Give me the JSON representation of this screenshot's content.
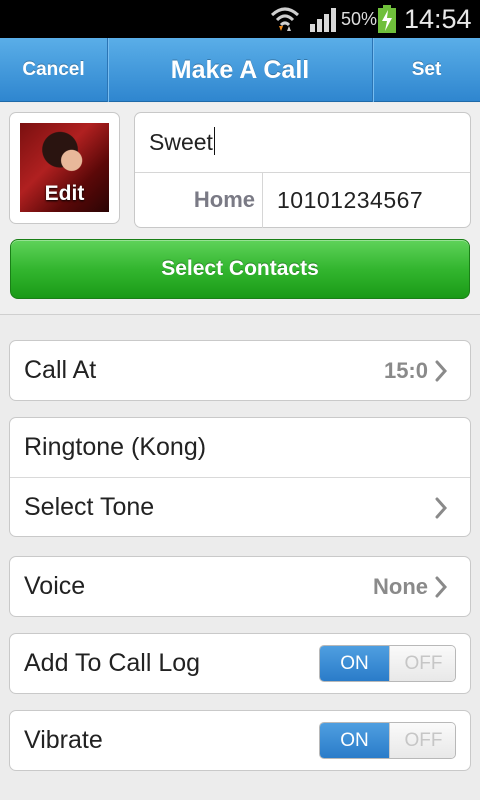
{
  "status_bar": {
    "battery_percent": "50%",
    "time": "14:54",
    "icons": [
      "wifi-icon",
      "signal-icon",
      "battery-charging-icon"
    ]
  },
  "header": {
    "cancel_label": "Cancel",
    "title": "Make A Call",
    "set_label": "Set",
    "background_color": "#3a93d8"
  },
  "contact": {
    "photo_label": "Edit",
    "name": "Sweet",
    "phone_type": "Home",
    "phone_number": "10101234567",
    "select_button_label": "Select Contacts",
    "select_button_color": "#2fb02b"
  },
  "settings": {
    "call_at": {
      "label": "Call At",
      "value": "15:0"
    },
    "ringtone": {
      "label": "Ringtone (Kong)",
      "select_label": "Select Tone"
    },
    "voice": {
      "label": "Voice",
      "value": "None"
    },
    "call_log": {
      "label": "Add To Call Log",
      "on_label": "ON",
      "off_label": "OFF",
      "state": "on"
    },
    "vibrate": {
      "label": "Vibrate",
      "on_label": "ON",
      "off_label": "OFF",
      "state": "on"
    }
  }
}
